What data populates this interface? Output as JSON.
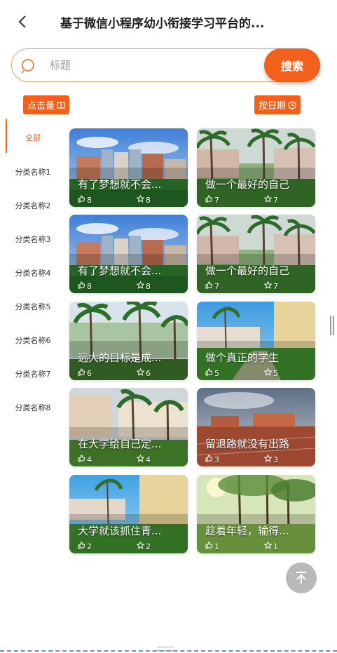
{
  "header": {
    "title": "基于微信小程序幼小衔接学习平台的...",
    "back_icon": "chevron-left-icon"
  },
  "search": {
    "placeholder": "标题",
    "value": "",
    "button_label": "搜索",
    "icon": "search-icon"
  },
  "sort": {
    "clicks_label": "点击量",
    "clicks_icon": "book-icon",
    "date_label": "按日期",
    "date_icon": "clock-icon"
  },
  "sidebar": {
    "items": [
      {
        "label": "全部",
        "active": true
      },
      {
        "label": "分类名称1",
        "active": false
      },
      {
        "label": "分类名称2",
        "active": false
      },
      {
        "label": "分类名称3",
        "active": false
      },
      {
        "label": "分类名称4",
        "active": false
      },
      {
        "label": "分类名称5",
        "active": false
      },
      {
        "label": "分类名称6",
        "active": false
      },
      {
        "label": "分类名称7",
        "active": false
      },
      {
        "label": "分类名称8",
        "active": false
      }
    ]
  },
  "cards": [
    {
      "title": "有了梦想就不会...",
      "likes": "8",
      "favorites": "8",
      "scene": "campus-buildings"
    },
    {
      "title": "做一个最好的自己",
      "likes": "7",
      "favorites": "7",
      "scene": "palm-lawn"
    },
    {
      "title": "有了梦想就不会...",
      "likes": "8",
      "favorites": "8",
      "scene": "campus-buildings"
    },
    {
      "title": "做一个最好的自己",
      "likes": "7",
      "favorites": "7",
      "scene": "palm-lawn"
    },
    {
      "title": "远大的目标是成...",
      "likes": "6",
      "favorites": "6",
      "scene": "palm-trees"
    },
    {
      "title": "做个真正的学生",
      "likes": "5",
      "favorites": "5",
      "scene": "courtyard"
    },
    {
      "title": "在大学给自己定...",
      "likes": "4",
      "favorites": "4",
      "scene": "dorm-palms"
    },
    {
      "title": "留退路就没有出路",
      "likes": "3",
      "favorites": "3",
      "scene": "track-field"
    },
    {
      "title": "大学就该抓住青...",
      "likes": "2",
      "favorites": "2",
      "scene": "courtyard-2"
    },
    {
      "title": "趁着年轻，输得...",
      "likes": "1",
      "favorites": "1",
      "scene": "sunny-park"
    }
  ],
  "colors": {
    "accent": "#f2601c",
    "search_border": "#e8a068",
    "totop_bg": "#b9b9b9"
  },
  "back_to_top_icon": "arrow-up-icon",
  "like_icon": "thumb-up-icon",
  "favorite_icon": "star-icon"
}
